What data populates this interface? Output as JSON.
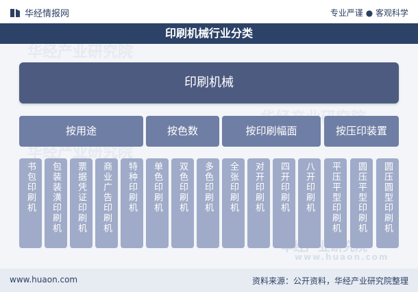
{
  "header": {
    "brand": "华经情报网",
    "slogan": "专业严谨 ● 客观科学"
  },
  "title": "印刷机械行业分类",
  "diagram": {
    "root": "印刷机械",
    "categories": [
      {
        "label": "按用途",
        "items": [
          "书包印刷机",
          "包装装潢印刷机",
          "票据凭证印刷机",
          "商业广告印刷机",
          "特种印刷机"
        ]
      },
      {
        "label": "按色数",
        "items": [
          "单色印刷机",
          "双色印刷机",
          "多色印刷机"
        ]
      },
      {
        "label": "按印刷幅面",
        "items": [
          "全张印刷机",
          "对开印刷机",
          "四开印刷机",
          "八开印刷机"
        ]
      },
      {
        "label": "按压印装置",
        "items": [
          "平压平型印刷机",
          "圆压平型印刷机",
          "圆压圆型印刷机"
        ]
      }
    ]
  },
  "watermark": {
    "brand": "华经产业研究院",
    "url": "www.huaon.com"
  },
  "footer": {
    "site": "www.huaon.com",
    "source": "资料来源：公开资料，华经产业研究院整理"
  },
  "colors": {
    "title_bar": "#2c4267",
    "root": "#4d5b80",
    "category": "#6f7ea4",
    "leaf": "#9fabc8",
    "footer": "#e7ebf2"
  }
}
